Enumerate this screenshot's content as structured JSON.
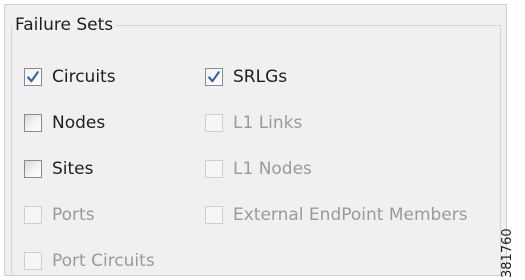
{
  "group": {
    "title": "Failure Sets"
  },
  "options": {
    "circuits": {
      "label": "Circuits",
      "checked": true,
      "enabled": true
    },
    "srlgs": {
      "label": "SRLGs",
      "checked": true,
      "enabled": true
    },
    "nodes": {
      "label": "Nodes",
      "checked": false,
      "enabled": true
    },
    "l1_links": {
      "label": "L1 Links",
      "checked": false,
      "enabled": false
    },
    "sites": {
      "label": "Sites",
      "checked": false,
      "enabled": true
    },
    "l1_nodes": {
      "label": "L1 Nodes",
      "checked": false,
      "enabled": false
    },
    "ports": {
      "label": "Ports",
      "checked": false,
      "enabled": false
    },
    "external_endpoint_members": {
      "label": "External EndPoint Members",
      "checked": false,
      "enabled": false
    },
    "port_circuits": {
      "label": "Port Circuits",
      "checked": false,
      "enabled": false
    }
  },
  "figure_number": "381760",
  "colors": {
    "check_mark": "#2b5fb4",
    "panel_background": "#f0f0f0",
    "disabled_text": "#9a9a9a"
  }
}
